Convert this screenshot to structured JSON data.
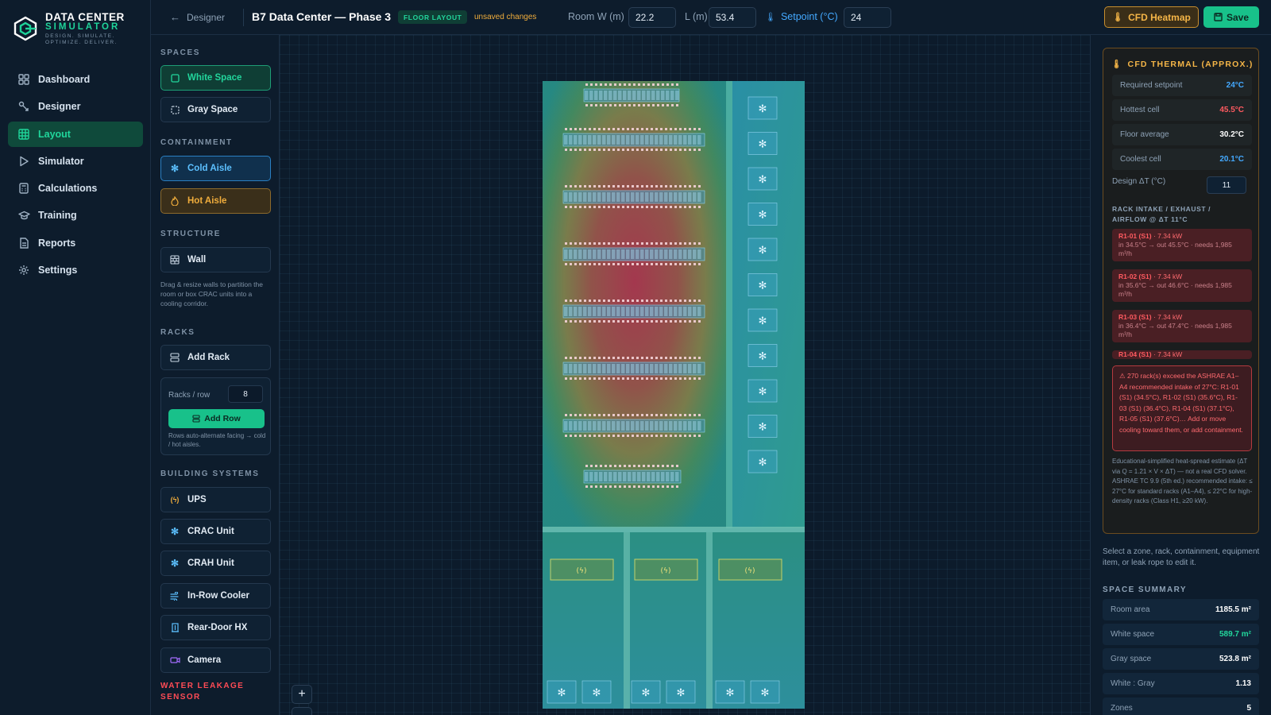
{
  "app": {
    "name_line1": "DATA CENTER",
    "name_line2": "SIMULATOR",
    "tagline": "DESIGN. SIMULATE. OPTIMIZE. DELIVER."
  },
  "nav": [
    {
      "label": "Dashboard",
      "icon": "grid-icon"
    },
    {
      "label": "Designer",
      "icon": "designer-icon"
    },
    {
      "label": "Layout",
      "icon": "layout-icon",
      "active": true
    },
    {
      "label": "Simulator",
      "icon": "play-icon"
    },
    {
      "label": "Calculations",
      "icon": "calculator-icon"
    },
    {
      "label": "Training",
      "icon": "graduation-cap-icon"
    },
    {
      "label": "Reports",
      "icon": "report-icon"
    },
    {
      "label": "Settings",
      "icon": "gear-icon"
    }
  ],
  "header": {
    "back_label": "Designer",
    "title": "B7 Data Center — Phase 3",
    "badge": "FLOOR LAYOUT",
    "unsaved": "unsaved changes",
    "room_w_label": "Room W (m)",
    "room_w": "22.2",
    "room_l_label": "L (m)",
    "room_l": "53.4",
    "setpoint_label": "Setpoint (°C)",
    "setpoint": "24",
    "cfd_button": "CFD Heatmap",
    "save_button": "Save"
  },
  "tools": {
    "spaces_title": "SPACES",
    "white_space": "White Space",
    "gray_space": "Gray Space",
    "containment_title": "CONTAINMENT",
    "cold_aisle": "Cold Aisle",
    "hot_aisle": "Hot Aisle",
    "structure_title": "STRUCTURE",
    "wall": "Wall",
    "wall_hint": "Drag & resize walls to partition the room or box CRAC units into a cooling corridor.",
    "racks_title": "RACKS",
    "add_rack": "Add Rack",
    "racks_per_row_label": "Racks / row",
    "racks_per_row": "8",
    "add_row": "Add Row",
    "row_hint": "Rows auto-alternate facing → cold / hot aisles.",
    "building_title": "BUILDING SYSTEMS",
    "ups": "UPS",
    "crac": "CRAC Unit",
    "crah": "CRAH Unit",
    "inrow": "In-Row Cooler",
    "reardoor": "Rear-Door HX",
    "camera": "Camera",
    "water_leak": "WATER LEAKAGE SENSOR"
  },
  "cfd": {
    "title": "CFD THERMAL (APPROX.)",
    "required_setpoint_label": "Required setpoint",
    "required_setpoint": "24°C",
    "hottest_label": "Hottest cell",
    "hottest": "45.5°C",
    "average_label": "Floor average",
    "average": "30.2°C",
    "coolest_label": "Coolest cell",
    "coolest": "20.1°C",
    "design_dt_label": "Design ΔT (°C)",
    "design_dt": "11",
    "rack_header": "RACK INTAKE / EXHAUST / AIRFLOW @ ΔT 11°C",
    "racks": [
      {
        "name": "R1-01 (S1)",
        "power": "· 7.34 kW",
        "detail": "in 34.5°C → out 45.5°C · needs 1,985 m³/h"
      },
      {
        "name": "R1-02 (S1)",
        "power": "· 7.34 kW",
        "detail": "in 35.6°C → out 46.6°C · needs 1,985 m³/h"
      },
      {
        "name": "R1-03 (S1)",
        "power": "· 7.34 kW",
        "detail": "in 36.4°C → out 47.4°C · needs 1,985 m³/h"
      },
      {
        "name": "R1-04 (S1)",
        "power": "· 7.34 kW",
        "detail": ""
      }
    ],
    "warning": "⚠ 270 rack(s) exceed the ASHRAE A1–A4 recommended intake of 27°C: R1-01 (S1) (34.5°C), R1-02 (S1) (35.6°C), R1-03 (S1) (36.4°C), R1-04 (S1) (37.1°C), R1-05 (S1) (37.6°C)… Add or move cooling toward them, or add containment.",
    "note": "Educational-simplified heat-spread estimate (ΔT via Q = 1.21 × V × ΔT) — not a real CFD solver. ASHRAE TC 9.9 (5th ed.) recommended intake: ≤ 27°C for standard racks (A1–A4), ≤ 22°C for high-density racks (Class H1, ≥20 kW)."
  },
  "select_hint": "Select a zone, rack, containment, equipment item, or leak rope to edit it.",
  "summary": {
    "title": "SPACE SUMMARY",
    "items": [
      {
        "label": "Room area",
        "value": "1185.5 m²"
      },
      {
        "label": "White space",
        "value": "589.7 m²"
      },
      {
        "label": "Gray space",
        "value": "523.8 m²"
      },
      {
        "label": "White : Gray",
        "value": "1.13"
      },
      {
        "label": "Zones",
        "value": "5"
      }
    ]
  },
  "colors": {
    "accent": "#18c18a",
    "cold": "#5cc0ff",
    "hot": "#f0ad3c",
    "danger": "#ff5a60"
  }
}
